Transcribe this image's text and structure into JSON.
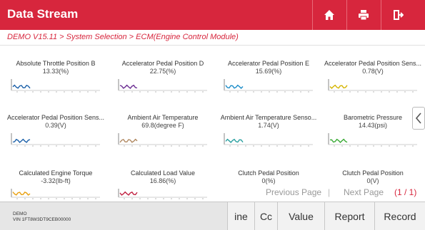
{
  "header": {
    "title": "Data Stream",
    "accent_color": "#d7263d",
    "buttons": [
      {
        "icon": "home-icon"
      },
      {
        "icon": "print-icon"
      },
      {
        "icon": "exit-icon"
      }
    ]
  },
  "breadcrumb": "DEMO V15.11 > System Selection > ECM(Engine Control Module)",
  "tiles": [
    {
      "name": "Absolute Throttle Position B",
      "value": "13.33(%)",
      "trace_color": "#1a5fa8"
    },
    {
      "name": "Accelerator Pedal Position D",
      "value": "22.75(%)",
      "trace_color": "#6a2c91"
    },
    {
      "name": "Accelerator Pedal Position E",
      "value": "15.69(%)",
      "trace_color": "#1a8cc8"
    },
    {
      "name": "Accelerator Pedal Position Sens...",
      "value": "0.78(V)",
      "trace_color": "#d4b400"
    },
    {
      "name": "Accelerator Pedal Position Sens...",
      "value": "0.39(V)",
      "trace_color": "#1a5fa8"
    },
    {
      "name": "Ambient Air Temperature",
      "value": "69.8(degree F)",
      "trace_color": "#b08860"
    },
    {
      "name": "Ambient Air Temperature Senso...",
      "value": "1.74(V)",
      "trace_color": "#2aa0a0"
    },
    {
      "name": "Barometric Pressure",
      "value": "14.43(psi)",
      "trace_color": "#3aaa35"
    },
    {
      "name": "Calculated Engine Torque",
      "value": "-3.32(lb-ft)",
      "trace_color": "#e8a010"
    },
    {
      "name": "Calculated Load Value",
      "value": "16.86(%)",
      "trace_color": "#c02040"
    },
    {
      "name": "Clutch Pedal Position",
      "value": "0(%)",
      "trace_color": "#888888"
    },
    {
      "name": "Clutch Pedal Position",
      "value": "0(V)",
      "trace_color": "#888888"
    }
  ],
  "pagination": {
    "previous": "Previous Page",
    "next": "Next Page",
    "count": "(1 / 1)"
  },
  "device": {
    "line1": "DEMO",
    "line2": "VIN 1FT8W3DT9CEB00000"
  },
  "footer_buttons": [
    "ine",
    "Cc",
    "Value",
    "Report",
    "Record"
  ]
}
